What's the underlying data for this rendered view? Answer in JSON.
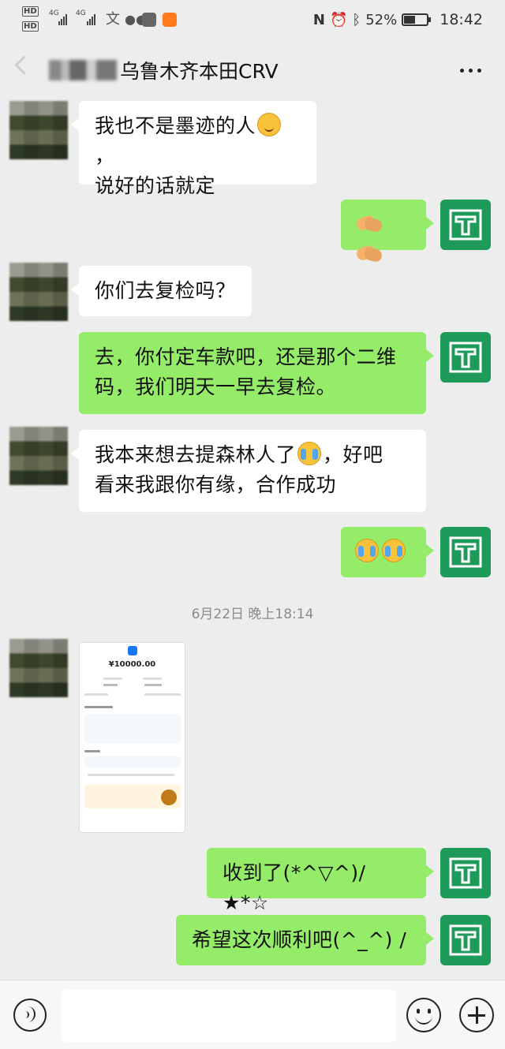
{
  "status_bar": {
    "hd1": "HD",
    "hd2": "HD",
    "net1": "4G",
    "net2": "4G",
    "battery_text": "52%",
    "battery_level": 0.52,
    "time": "18:42"
  },
  "header": {
    "title": "乌鲁木齐本田CRV"
  },
  "colors": {
    "background": "#ededed",
    "bubble_sent": "#95ec69",
    "bubble_received": "#ffffff",
    "avatar_self": "#1e9a5a"
  },
  "messages": [
    {
      "side": "left",
      "lines": [
        "我也不是墨迹的人",
        "说好的话就定"
      ],
      "emoji": "smile",
      "trailing": "，"
    },
    {
      "side": "right",
      "emoji": "handshake x2"
    },
    {
      "side": "left",
      "text": "你们去复检吗？"
    },
    {
      "side": "right",
      "lines": [
        "去，你付定车款吧，还是那个二维",
        "码，我们明天一早去复检。"
      ]
    },
    {
      "side": "left",
      "line1_a": "我本来想去提森林人了",
      "line1_b": "，好吧",
      "line2": "看来我跟你有缘，合作成功",
      "emoji": "cry"
    },
    {
      "side": "right",
      "emoji": "cry x2"
    },
    {
      "side": "right",
      "text": "收到了(*^▽^)/★*☆"
    },
    {
      "side": "right",
      "text": "希望这次顺利吧(^_^) /"
    }
  ],
  "timestamp": "6月22日 晚上18:14",
  "image_message": {
    "amount": "¥10000.00"
  },
  "input_bar": {
    "placeholder": ""
  },
  "icons": [
    "back-icon",
    "more-icon",
    "voice-icon",
    "emoji-icon",
    "plus-icon"
  ]
}
